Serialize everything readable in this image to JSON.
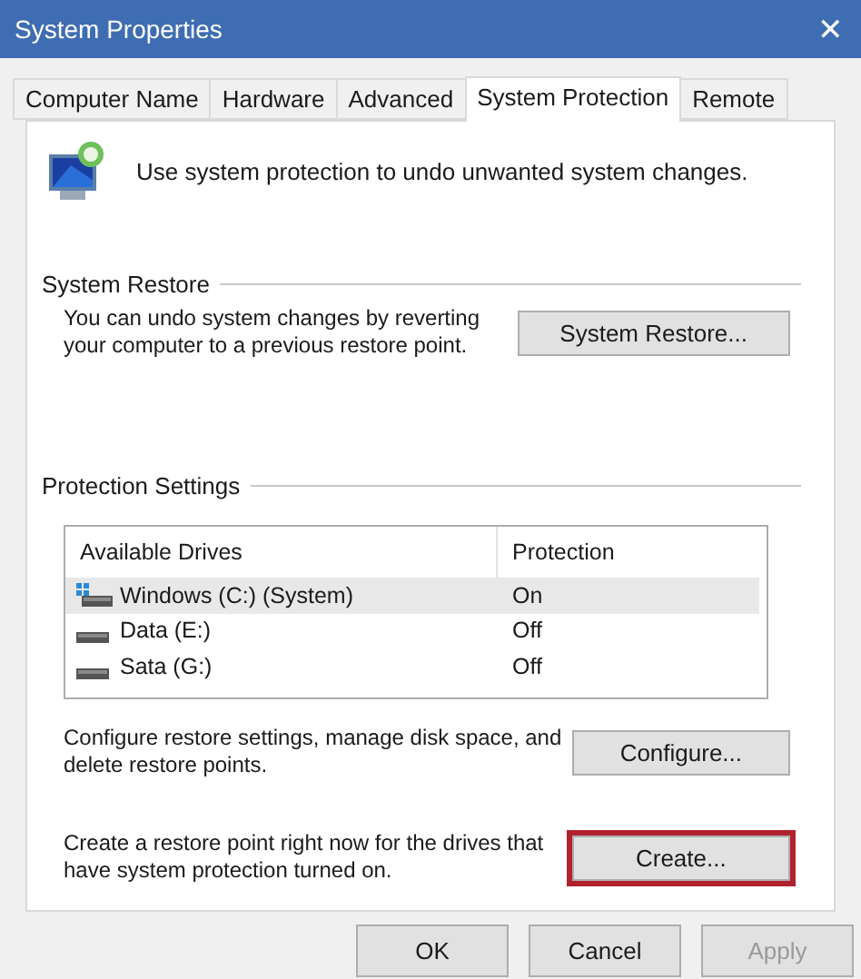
{
  "window": {
    "title": "System Properties",
    "close": "✕"
  },
  "tabs": [
    {
      "label": "Computer Name",
      "selected": false
    },
    {
      "label": "Hardware",
      "selected": false
    },
    {
      "label": "Advanced",
      "selected": false
    },
    {
      "label": "System Protection",
      "selected": true
    },
    {
      "label": "Remote",
      "selected": false
    }
  ],
  "intro": "Use system protection to undo unwanted system changes.",
  "system_restore": {
    "title": "System Restore",
    "text": "You can undo system changes by reverting your computer to a previous restore point.",
    "button": {
      "label": "System Restore..."
    }
  },
  "protection_settings": {
    "title": "Protection Settings",
    "columns": [
      "Available Drives",
      "Protection"
    ],
    "rows": [
      {
        "drive": "Windows (C:) (System)",
        "protection": "On",
        "system": true,
        "selected": true
      },
      {
        "drive": "Data (E:)",
        "protection": "Off",
        "system": false,
        "selected": false
      },
      {
        "drive": "Sata (G:)",
        "protection": "Off",
        "system": false,
        "selected": false
      }
    ],
    "actions": [
      {
        "text": "Configure restore settings, manage disk space, and delete restore points.",
        "button": {
          "label": "Configure...",
          "highlighted": false
        }
      },
      {
        "text": "Create a restore point right now for the drives that have system protection turned on.",
        "button": {
          "label": "Create...",
          "highlighted": true
        }
      }
    ]
  },
  "buttons": [
    {
      "label": "OK",
      "disabled": false
    },
    {
      "label": "Cancel",
      "disabled": false
    },
    {
      "label": "Apply",
      "disabled": true
    }
  ]
}
